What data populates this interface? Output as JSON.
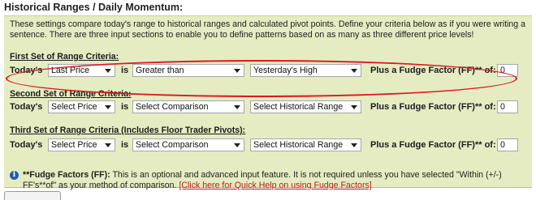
{
  "page": {
    "title": "Historical Ranges / Daily Momentum:",
    "intro": "These settings compare today's range to historical ranges and calculated pivot points. Define your criteria below as if you were writing a sentence. There are three input sections to enable you to define patterns based on as many as three different price levels!"
  },
  "sections": [
    {
      "heading": "First Set of Range Criteria:",
      "todays_label": "Today's",
      "price": "Last Price",
      "is_label": "is",
      "comparison": "Greater than",
      "historical": "Yesterday's High",
      "fudge_label": "Plus a Fudge Factor (FF)** of:",
      "fudge_value": "0"
    },
    {
      "heading": "Second Set of Range Criteria:",
      "todays_label": "Today's",
      "price": "Select Price",
      "is_label": "is",
      "comparison": "Select Comparison",
      "historical": "Select Historical Range",
      "fudge_label": "Plus a Fudge Factor (FF)** of:",
      "fudge_value": "0"
    },
    {
      "heading": "Third Set of Range Criteria (Includes Floor Trader Pivots):",
      "todays_label": "Today's",
      "price": "Select Price",
      "is_label": "is",
      "comparison": "Select Comparison",
      "historical": "Select Historical Range",
      "fudge_label": "Plus a Fudge Factor (FF)** of:",
      "fudge_value": "0"
    }
  ],
  "note": {
    "icon": "info-icon",
    "bold": "**Fudge Factors (FF):",
    "text": " This is an optional and advanced input feature. It is not required unless you have selected \"Within (+/-) FF's**of\" as your method of comparison. ",
    "link": "[Click here for Quick Help on using Fudge Factors]"
  },
  "colors": {
    "panel_bg": "#e5ecc2",
    "highlight": "#e0161d",
    "link": "#b81c1c",
    "info_icon": "#1e5fb3"
  }
}
